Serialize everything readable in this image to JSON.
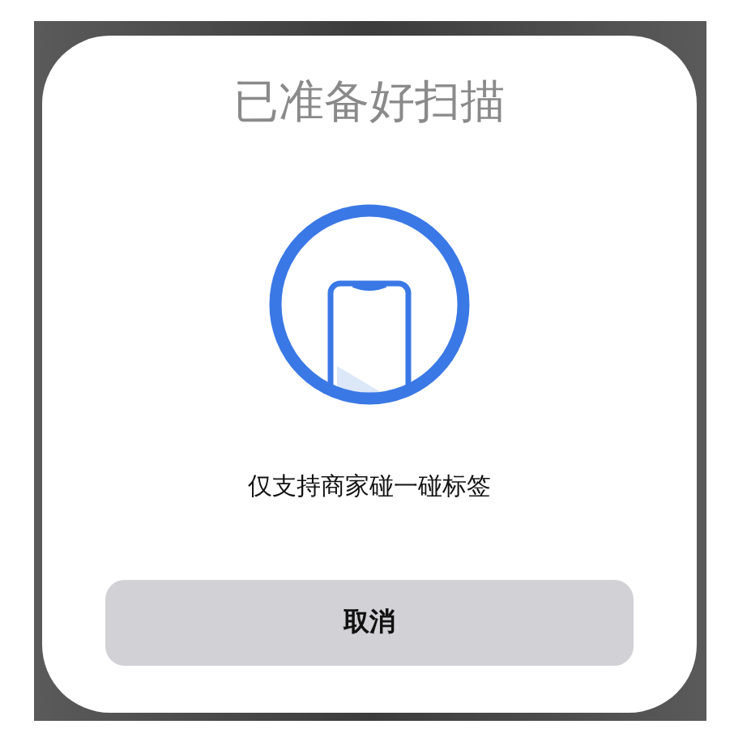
{
  "dialog": {
    "title": "已准备好扫描",
    "message": "仅支持商家碰一碰标签",
    "buttons": [
      {
        "label": "取消",
        "kind": "cancel"
      }
    ]
  }
}
